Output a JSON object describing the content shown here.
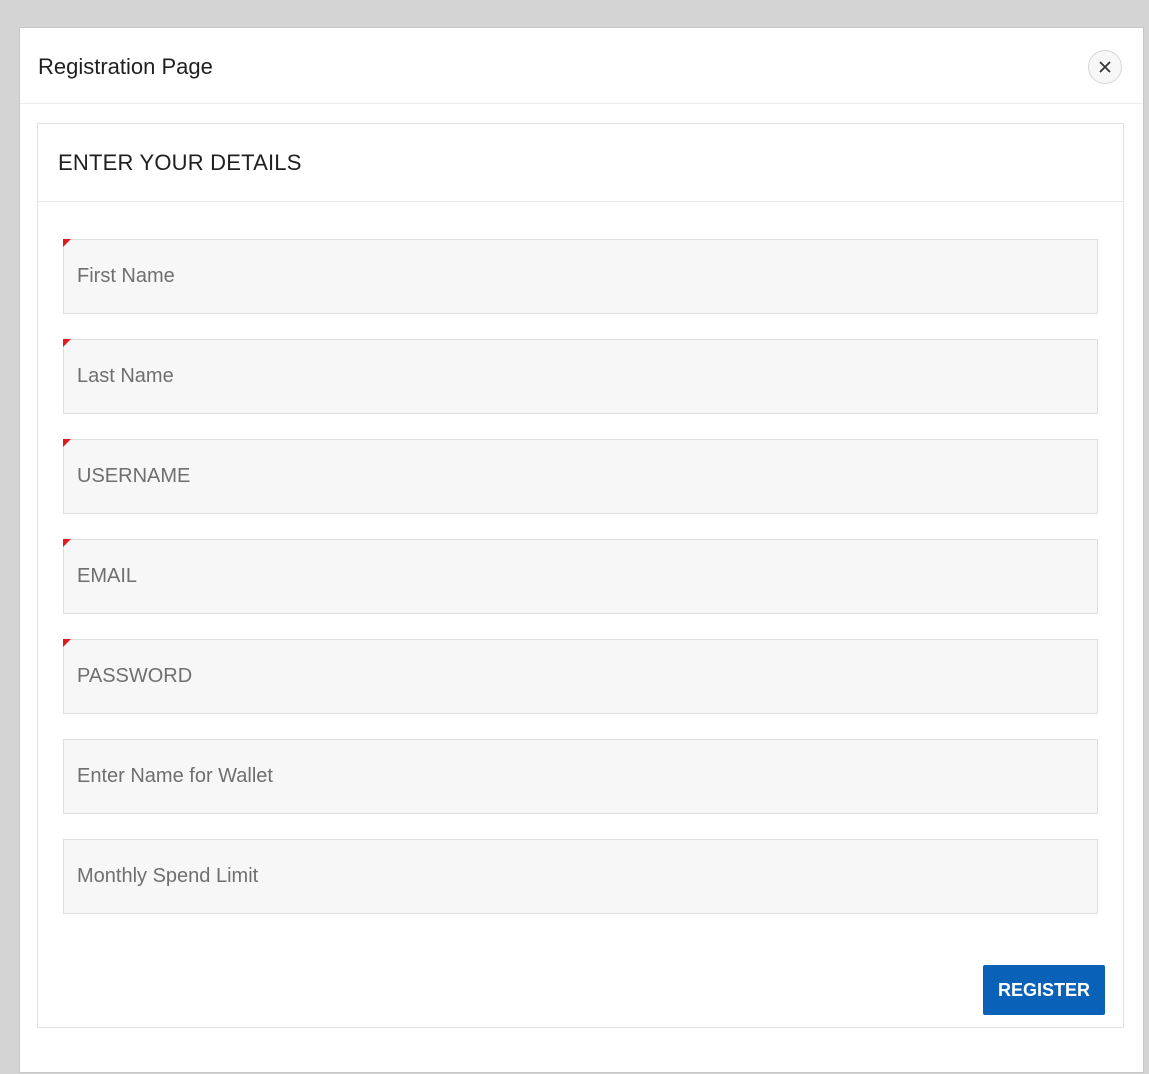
{
  "dialog": {
    "title": "Registration Page",
    "close_icon": "close-icon"
  },
  "region": {
    "title": "ENTER YOUR DETAILS"
  },
  "fields": [
    {
      "placeholder": "First Name",
      "value": "",
      "required": true
    },
    {
      "placeholder": "Last Name",
      "value": "",
      "required": true
    },
    {
      "placeholder": "USERNAME",
      "value": "",
      "required": true
    },
    {
      "placeholder": "EMAIL",
      "value": "",
      "required": true
    },
    {
      "placeholder": "PASSWORD",
      "value": "",
      "required": true
    },
    {
      "placeholder": "Enter Name for Wallet",
      "value": "",
      "required": false
    },
    {
      "placeholder": "Monthly Spend Limit",
      "value": "",
      "required": false
    }
  ],
  "actions": {
    "register_label": "REGISTER"
  },
  "colors": {
    "accent": "#0a62b8",
    "required_marker": "#e01b1b"
  }
}
